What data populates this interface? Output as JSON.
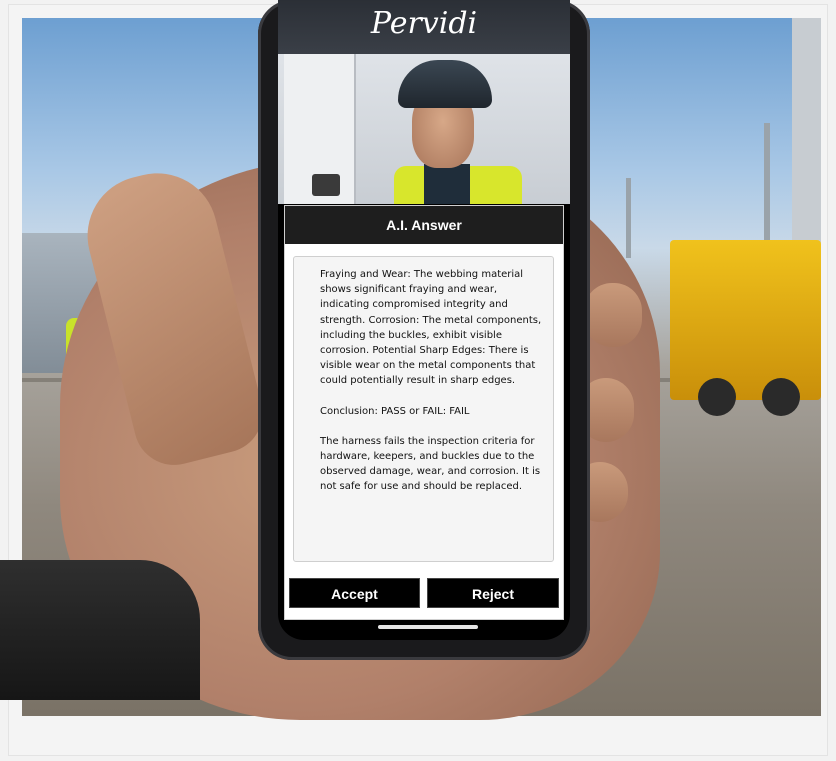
{
  "app": {
    "brand": "Pervidi"
  },
  "answer_panel": {
    "title": "A.I. Answer",
    "paragraphs": [
      "Fraying and Wear: The webbing material shows significant fraying and wear, indicating compromised integrity and strength. Corrosion: The metal components, including the buckles, exhibit visible corrosion. Potential Sharp Edges: There is visible wear on the metal components that could potentially result in sharp edges.",
      "Conclusion: PASS or FAIL: FAIL",
      "The harness fails the inspection criteria for hardware, keepers, and buckles due to the observed damage, wear, and corrosion. It is not safe for use and should be replaced."
    ]
  },
  "actions": {
    "accept_label": "Accept",
    "reject_label": "Reject"
  },
  "colors": {
    "header_bg": "#1e1e1e",
    "button_bg": "#000000",
    "text": "#111111"
  }
}
